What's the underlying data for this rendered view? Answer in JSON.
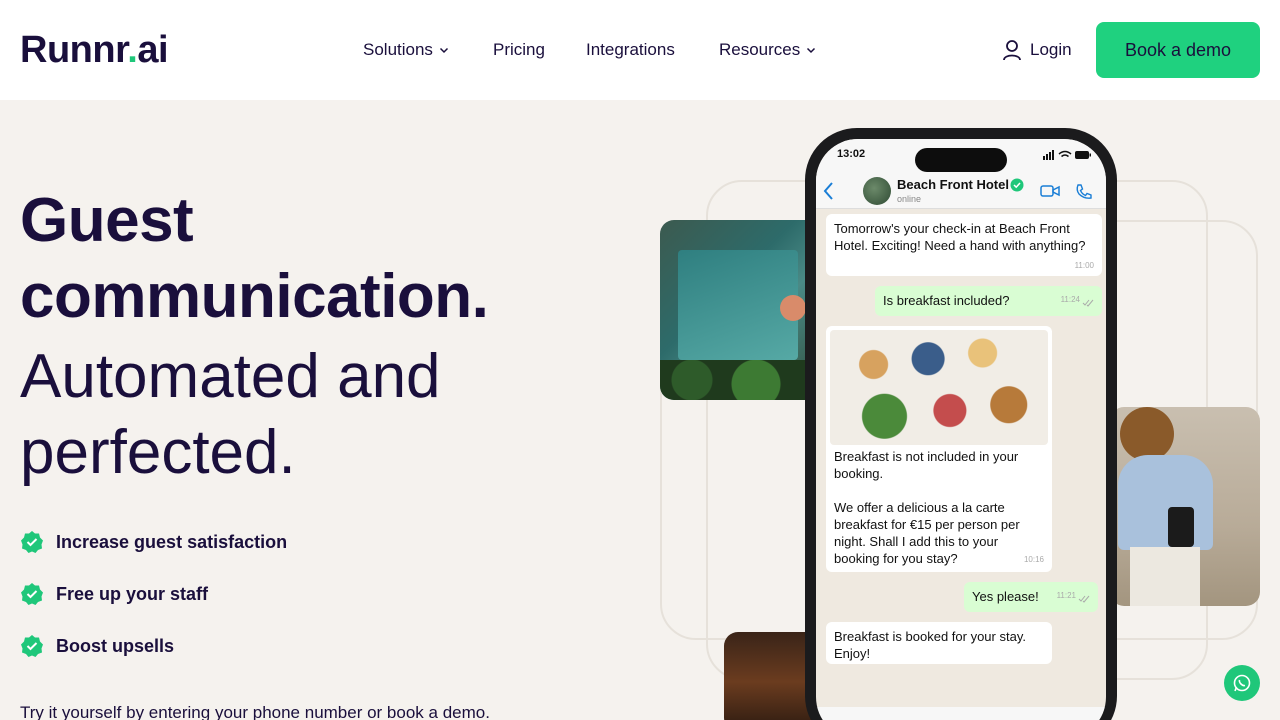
{
  "brand": {
    "logo_main": "Runnr",
    "logo_dot": ".",
    "logo_suffix": "ai",
    "accent_color": "#1fd17f",
    "text_color": "#1a0f3c"
  },
  "nav": {
    "items": [
      {
        "label": "Solutions",
        "has_dropdown": true
      },
      {
        "label": "Pricing",
        "has_dropdown": false
      },
      {
        "label": "Integrations",
        "has_dropdown": false
      },
      {
        "label": "Resources",
        "has_dropdown": true
      }
    ],
    "login_label": "Login",
    "cta_label": "Book a demo"
  },
  "hero": {
    "headline_line1": "Guest",
    "headline_line2": "communication.",
    "subline_line1": "Automated and",
    "subline_line2": "perfected.",
    "bullets": [
      "Increase guest satisfaction",
      "Free up your staff",
      "Boost upsells"
    ],
    "footer_text": "Try it yourself by entering your phone number or book a demo."
  },
  "phone": {
    "time": "13:02",
    "contact_name": "Beach Front Hotel",
    "contact_status": "online",
    "messages": [
      {
        "direction": "in",
        "text": "Tomorrow's your check-in at Beach Front Hotel. Exciting! Need a hand with anything?",
        "time": "11:00"
      },
      {
        "direction": "out",
        "text": "Is breakfast included?",
        "time": "11:24"
      },
      {
        "direction": "in",
        "image": "breakfast-photo",
        "text_p1": "Breakfast is not included in your booking.",
        "text_p2": "We offer a delicious a la carte breakfast for €15 per person per night. Shall I add this to your booking for you stay?",
        "time": "10:16"
      },
      {
        "direction": "out",
        "text": "Yes please!",
        "time": "11:21"
      },
      {
        "direction": "in",
        "text": "Breakfast is booked for your stay. Enjoy!"
      }
    ]
  },
  "icons": {
    "user": "user-icon",
    "chevron": "chevron-down-icon",
    "check": "check-badge-icon",
    "whatsapp": "whatsapp-icon"
  }
}
